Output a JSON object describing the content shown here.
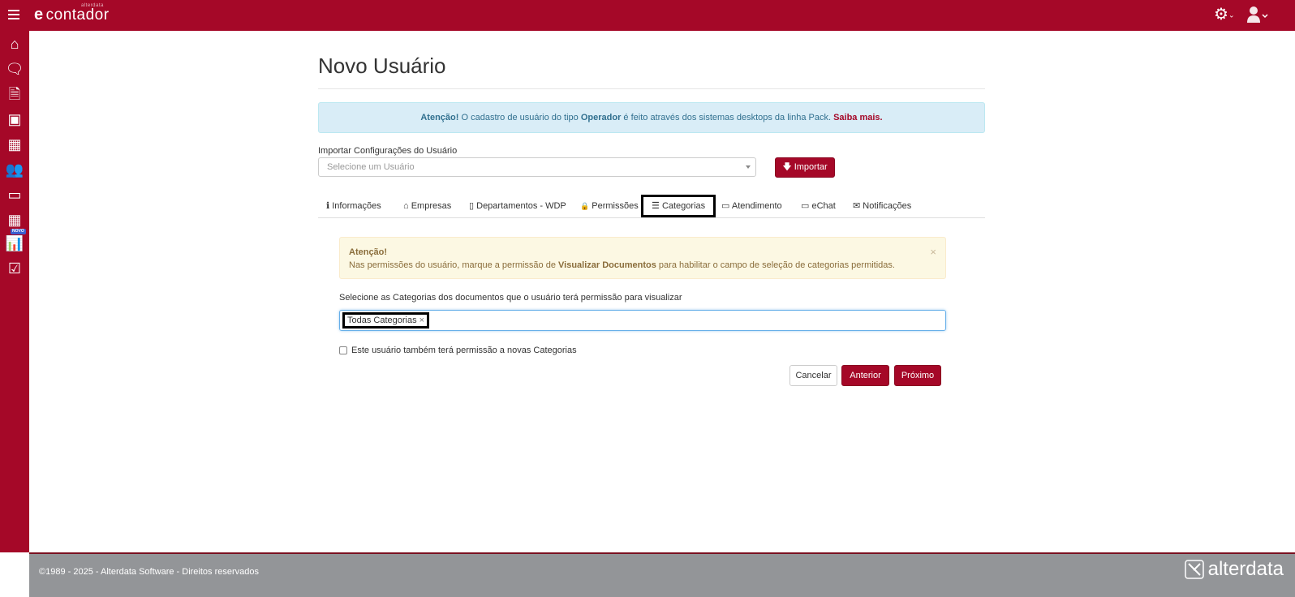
{
  "header": {
    "logo_main": "contador",
    "logo_prefix": "e",
    "logo_small": "alterdata"
  },
  "sidebar": {
    "items": [
      "home",
      "chat",
      "documents",
      "contacts",
      "companies",
      "users",
      "payments",
      "calculator",
      "reports",
      "tasks"
    ],
    "novo_badge": "NOVO"
  },
  "page": {
    "title": "Novo Usuário"
  },
  "info_alert": {
    "strong": "Atenção!",
    "text1": " O cadastro de usuário do tipo ",
    "bold": "Operador",
    "text2": " é feito através dos sistemas desktops da linha Pack. ",
    "link": "Saiba mais."
  },
  "import": {
    "label": "Importar Configurações do Usuário",
    "placeholder": "Selecione um Usuário",
    "button": "Importar"
  },
  "tabs": [
    {
      "label": "Informações",
      "icon": "ℹ"
    },
    {
      "label": "Empresas",
      "icon": "⌂"
    },
    {
      "label": "Departamentos - WDP",
      "icon": "▯"
    },
    {
      "label": "Permissões",
      "icon": "🔒"
    },
    {
      "label": "Categorias",
      "icon": "☰"
    },
    {
      "label": "Atendimento",
      "icon": "▭"
    },
    {
      "label": "eChat",
      "icon": "▭"
    },
    {
      "label": "Notificações",
      "icon": "✉"
    }
  ],
  "warning": {
    "title": "Atenção!",
    "text1": "Nas permissões do usuário, marque a permissão de ",
    "bold": "Visualizar Documentos",
    "text2": " para habilitar o campo de seleção de categorias permitidas.",
    "close": "×"
  },
  "categories": {
    "label": "Selecione as Categorias dos documentos que o usuário terá permissão para visualizar",
    "tag": "Todas Categorias",
    "tag_remove": "×",
    "checkbox_label": "Este usuário também terá permissão a novas Categorias",
    "checked": false
  },
  "buttons": {
    "cancel": "Cancelar",
    "previous": "Anterior",
    "next": "Próximo"
  },
  "footer": {
    "copyright": "©1989 - 2025 - Alterdata Software - Direitos reservados",
    "brand": "alterdata"
  },
  "colors": {
    "brand": "#a50828",
    "footer": "#939598"
  }
}
